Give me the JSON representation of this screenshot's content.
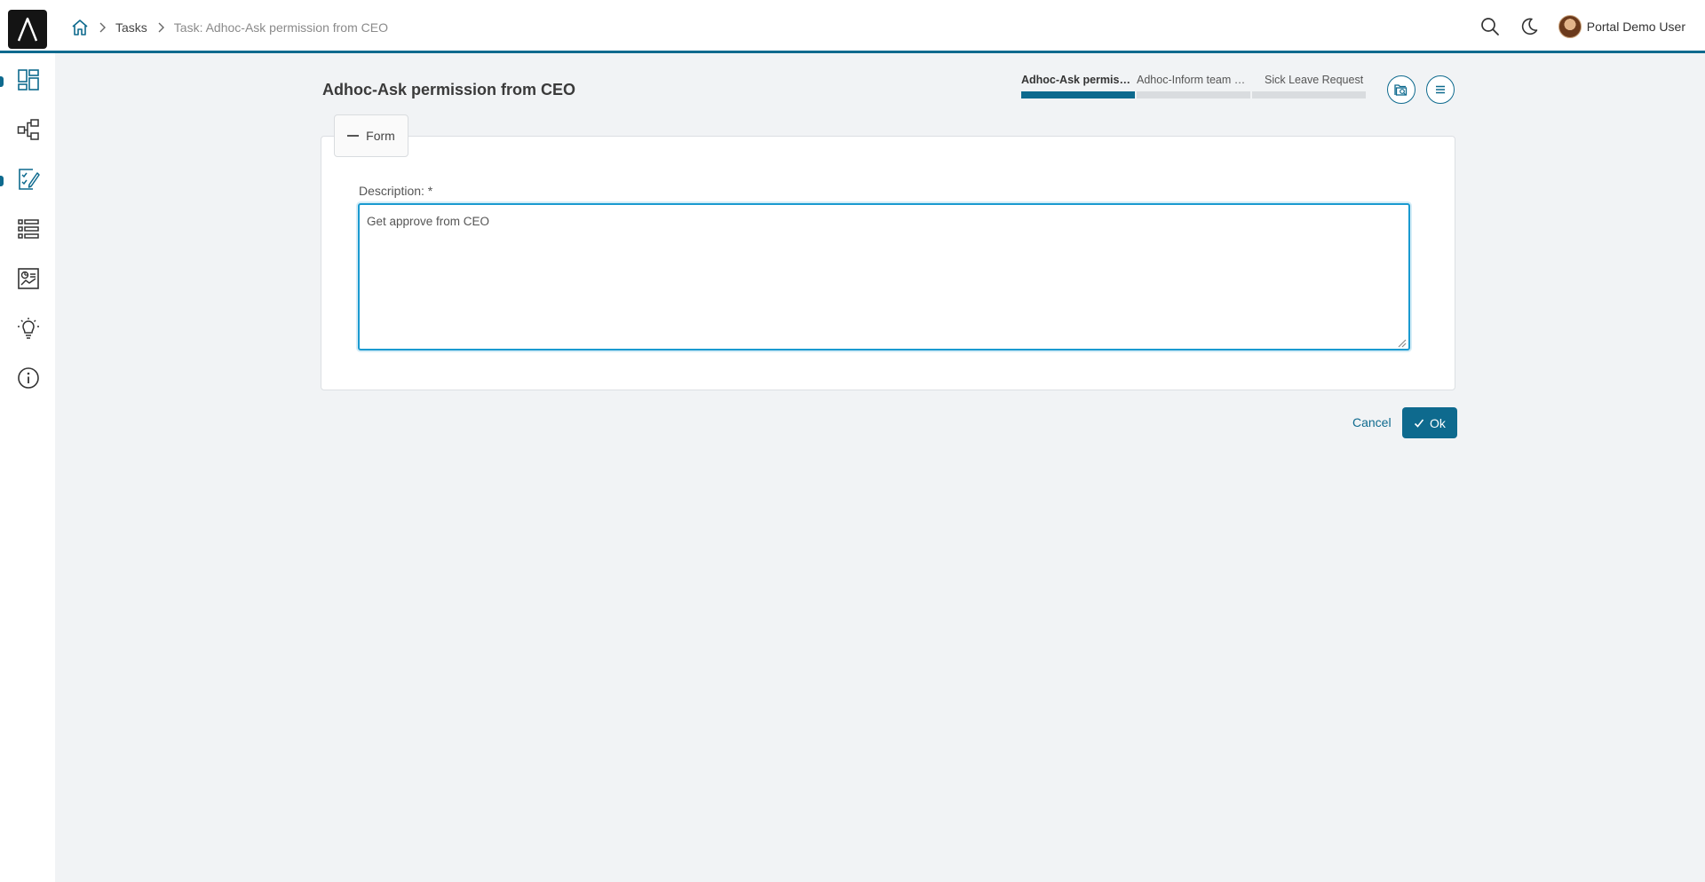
{
  "breadcrumb": {
    "home_icon": "home-icon",
    "items": [
      "Tasks",
      "Task: Adhoc-Ask permission from CEO"
    ]
  },
  "header": {
    "user_name": "Portal Demo User",
    "search_icon": "search-icon",
    "theme_icon": "moon-icon"
  },
  "sidebar": {
    "items": [
      {
        "icon": "dashboard-icon",
        "active_marker": true
      },
      {
        "icon": "process-icon",
        "active_marker": false
      },
      {
        "icon": "tasks-icon",
        "active_marker": true
      },
      {
        "icon": "list-icon",
        "active_marker": false
      },
      {
        "icon": "statistics-icon",
        "active_marker": false
      },
      {
        "icon": "idea-icon",
        "active_marker": false
      },
      {
        "icon": "info-icon",
        "active_marker": false
      }
    ]
  },
  "page": {
    "title": "Adhoc-Ask permission from CEO"
  },
  "steps": [
    {
      "label": "Adhoc-Ask permission from CEO",
      "active": true
    },
    {
      "label": "Adhoc-Inform team manager",
      "active": false
    },
    {
      "label": "Sick Leave Request",
      "active": false
    }
  ],
  "form": {
    "legend": "Form",
    "description_label": "Description: *",
    "description_value": "Get approve from CEO"
  },
  "actions": {
    "cancel_label": "Cancel",
    "ok_label": "Ok"
  },
  "colors": {
    "accent": "#0e6a8e",
    "focus": "#1a9ad0",
    "background": "#f1f3f5"
  }
}
